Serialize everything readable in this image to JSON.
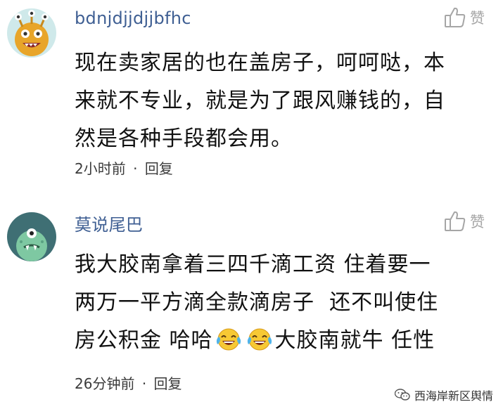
{
  "comments": [
    {
      "username": "bdnjdjjdjjbfhc",
      "content_lines": [
        "现在卖家居的也在盖房子，呵呵哒，本",
        "来就不专业，就是为了跟风赚钱的，自",
        "然是各种手段都会用。"
      ],
      "time": "2小时前",
      "separator": "·",
      "reply_label": "回复",
      "like_label": "赞",
      "like_icon": "thumbs-up-icon",
      "avatar_color": "#e8a52a"
    },
    {
      "username": "莫说尾巴",
      "content_lines": [
        "我大胶南拿着三四千滴工资 住着要一",
        "两万一平方滴全款滴房子  还不叫使住"
      ],
      "content_last_line_parts": {
        "before": "房公积金 哈哈",
        "after": "大胶南就牛 任性",
        "emoji": "crying-laughing-emoji"
      },
      "time": "26分钟前",
      "separator": "·",
      "reply_label": "回复",
      "like_label": "赞",
      "like_icon": "thumbs-up-icon",
      "avatar_color": "#3f6f74"
    }
  ],
  "watermark": {
    "text": "西海岸新区舆情",
    "icon": "wechat-icon"
  },
  "colors": {
    "username": "#3f5f93",
    "text": "#111111",
    "muted": "#a6a6a6"
  }
}
